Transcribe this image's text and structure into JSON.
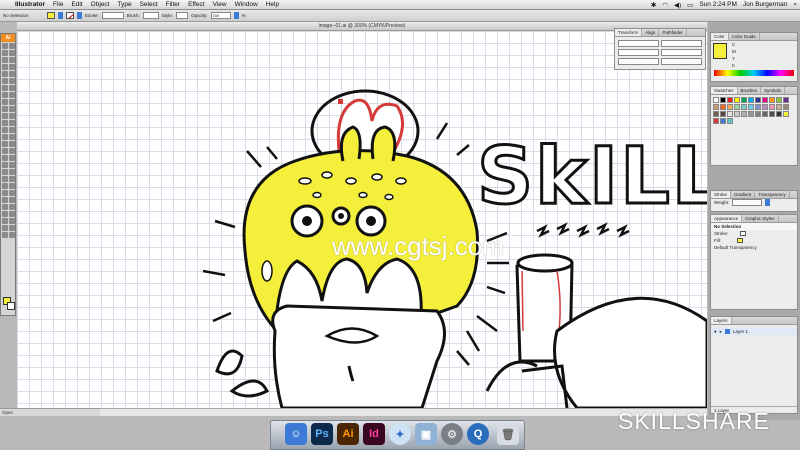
{
  "menubar": {
    "apple": "",
    "items": [
      "Illustrator",
      "File",
      "Edit",
      "Object",
      "Type",
      "Select",
      "Filter",
      "Effect",
      "View",
      "Window",
      "Help"
    ],
    "clock": "Sun 2:24 PM",
    "user": "Jon Burgerman"
  },
  "controlbar": {
    "selection": "No Selection",
    "stroke_label": "Stroke:",
    "brush_label": "Brush:",
    "style_label": "Style:",
    "opacity_label": "Opacity:",
    "opacity_value": "100",
    "opacity_unit": "%"
  },
  "toolbox": {
    "header": "Ai"
  },
  "document": {
    "tab_title": "image--01.ai @ 300% (CMYK/Preview)",
    "status": "Open"
  },
  "artwork": {
    "lettering": "SkILL"
  },
  "panels": {
    "transform": {
      "tabs": [
        "Transform",
        "Align",
        "Pathfinder"
      ]
    },
    "color": {
      "tabs": [
        "Color",
        "Color Guide"
      ],
      "channels": [
        "C",
        "M",
        "Y",
        "K"
      ]
    },
    "swatches": {
      "tabs": [
        "Swatches",
        "Brushes",
        "Symbols"
      ]
    },
    "stroke": {
      "tabs": [
        "Stroke",
        "Gradient",
        "Transparency"
      ],
      "weight_label": "Weight:"
    },
    "appearance": {
      "tabs": [
        "Appearance",
        "Graphic Styles"
      ],
      "header": "No Selection",
      "rows": [
        "Stroke:",
        "Fill:",
        "Default Transparency"
      ]
    },
    "layers": {
      "tabs": [
        "Layers"
      ],
      "layer_name": "Layer 1",
      "footer": "1 Layer"
    }
  },
  "watermarks": {
    "center": "www.cgtsj.com",
    "brand": "SKILLSHARE"
  },
  "colors": {
    "accent_yellow": "#f4ef3a",
    "illustrator_orange": "#f28c1f",
    "grid": "#d4dde8",
    "ink": "#111111",
    "red": "#d43a3a"
  }
}
